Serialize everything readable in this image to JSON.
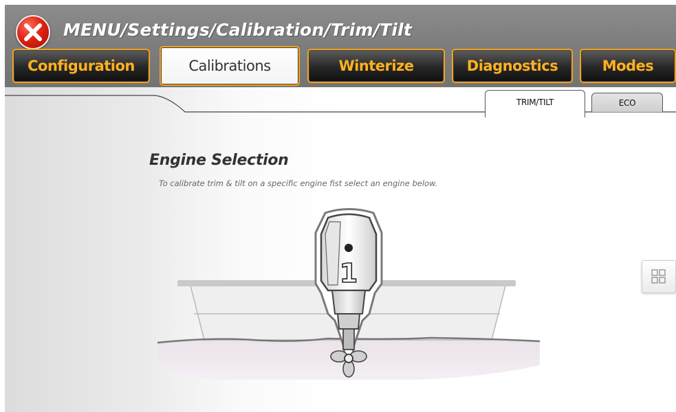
{
  "header": {
    "breadcrumb": "MENU/Settings/Calibration/Trim/Tilt"
  },
  "tabs": [
    {
      "label": "Configuration",
      "active": false
    },
    {
      "label": "Calibrations",
      "active": true
    },
    {
      "label": "Winterize",
      "active": false
    },
    {
      "label": "Diagnostics",
      "active": false
    },
    {
      "label": "Modes",
      "active": false
    }
  ],
  "subtabs": [
    {
      "label": "TRIM/TILT",
      "active": true
    },
    {
      "label": "ECO",
      "active": false
    }
  ],
  "engine_selection": {
    "title": "Engine Selection",
    "description": "To calibrate trim & tilt on a specific engine fist select an engine below.",
    "engine_number": "1"
  },
  "icons": {
    "close": "close-x-icon",
    "grid": "grid-view-icon"
  },
  "colors": {
    "accent_orange": "#f2a31c",
    "tab_text": "#ffb21e",
    "header_gray": "#7d7d7d",
    "close_red": "#e02412"
  }
}
